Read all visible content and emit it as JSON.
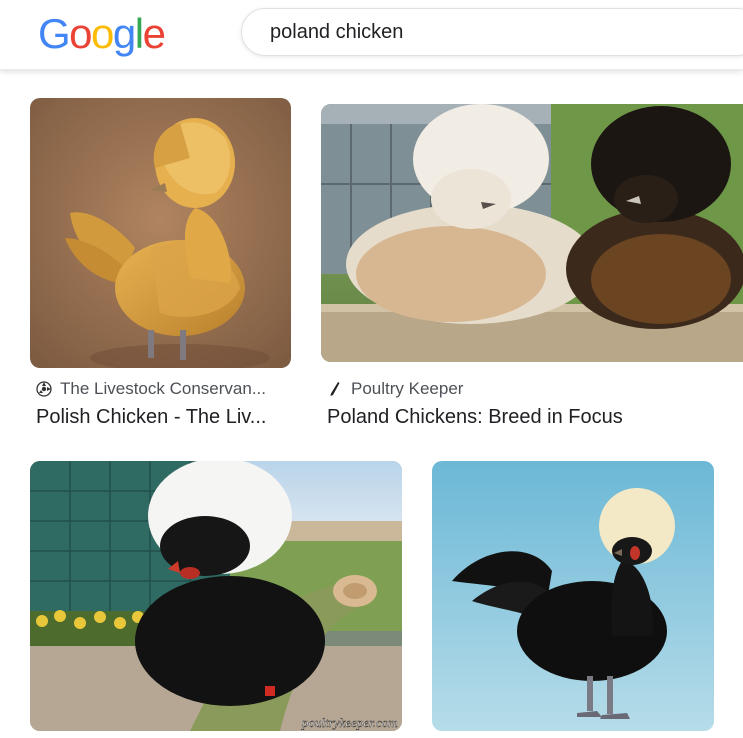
{
  "header": {
    "logo_letters": [
      {
        "char": "G",
        "color": "#4285F4"
      },
      {
        "char": "o",
        "color": "#EA4335"
      },
      {
        "char": "o",
        "color": "#FBBC05"
      },
      {
        "char": "g",
        "color": "#4285F4"
      },
      {
        "char": "l",
        "color": "#34A853"
      },
      {
        "char": "e",
        "color": "#EA4335"
      }
    ],
    "search_value": "poland chicken"
  },
  "results": [
    {
      "source_icon": "livestock-conservancy-icon",
      "source": "The Livestock Conservan...",
      "title": "Polish Chicken - The Liv..."
    },
    {
      "source_icon": "poultry-keeper-icon",
      "source": "Poultry Keeper",
      "title": "Poland Chickens: Breed in Focus"
    },
    {
      "source_icon": "",
      "source": "",
      "title": ""
    },
    {
      "source_icon": "",
      "source": "",
      "title": ""
    }
  ],
  "watermark_text": "poultrykeeper.com"
}
